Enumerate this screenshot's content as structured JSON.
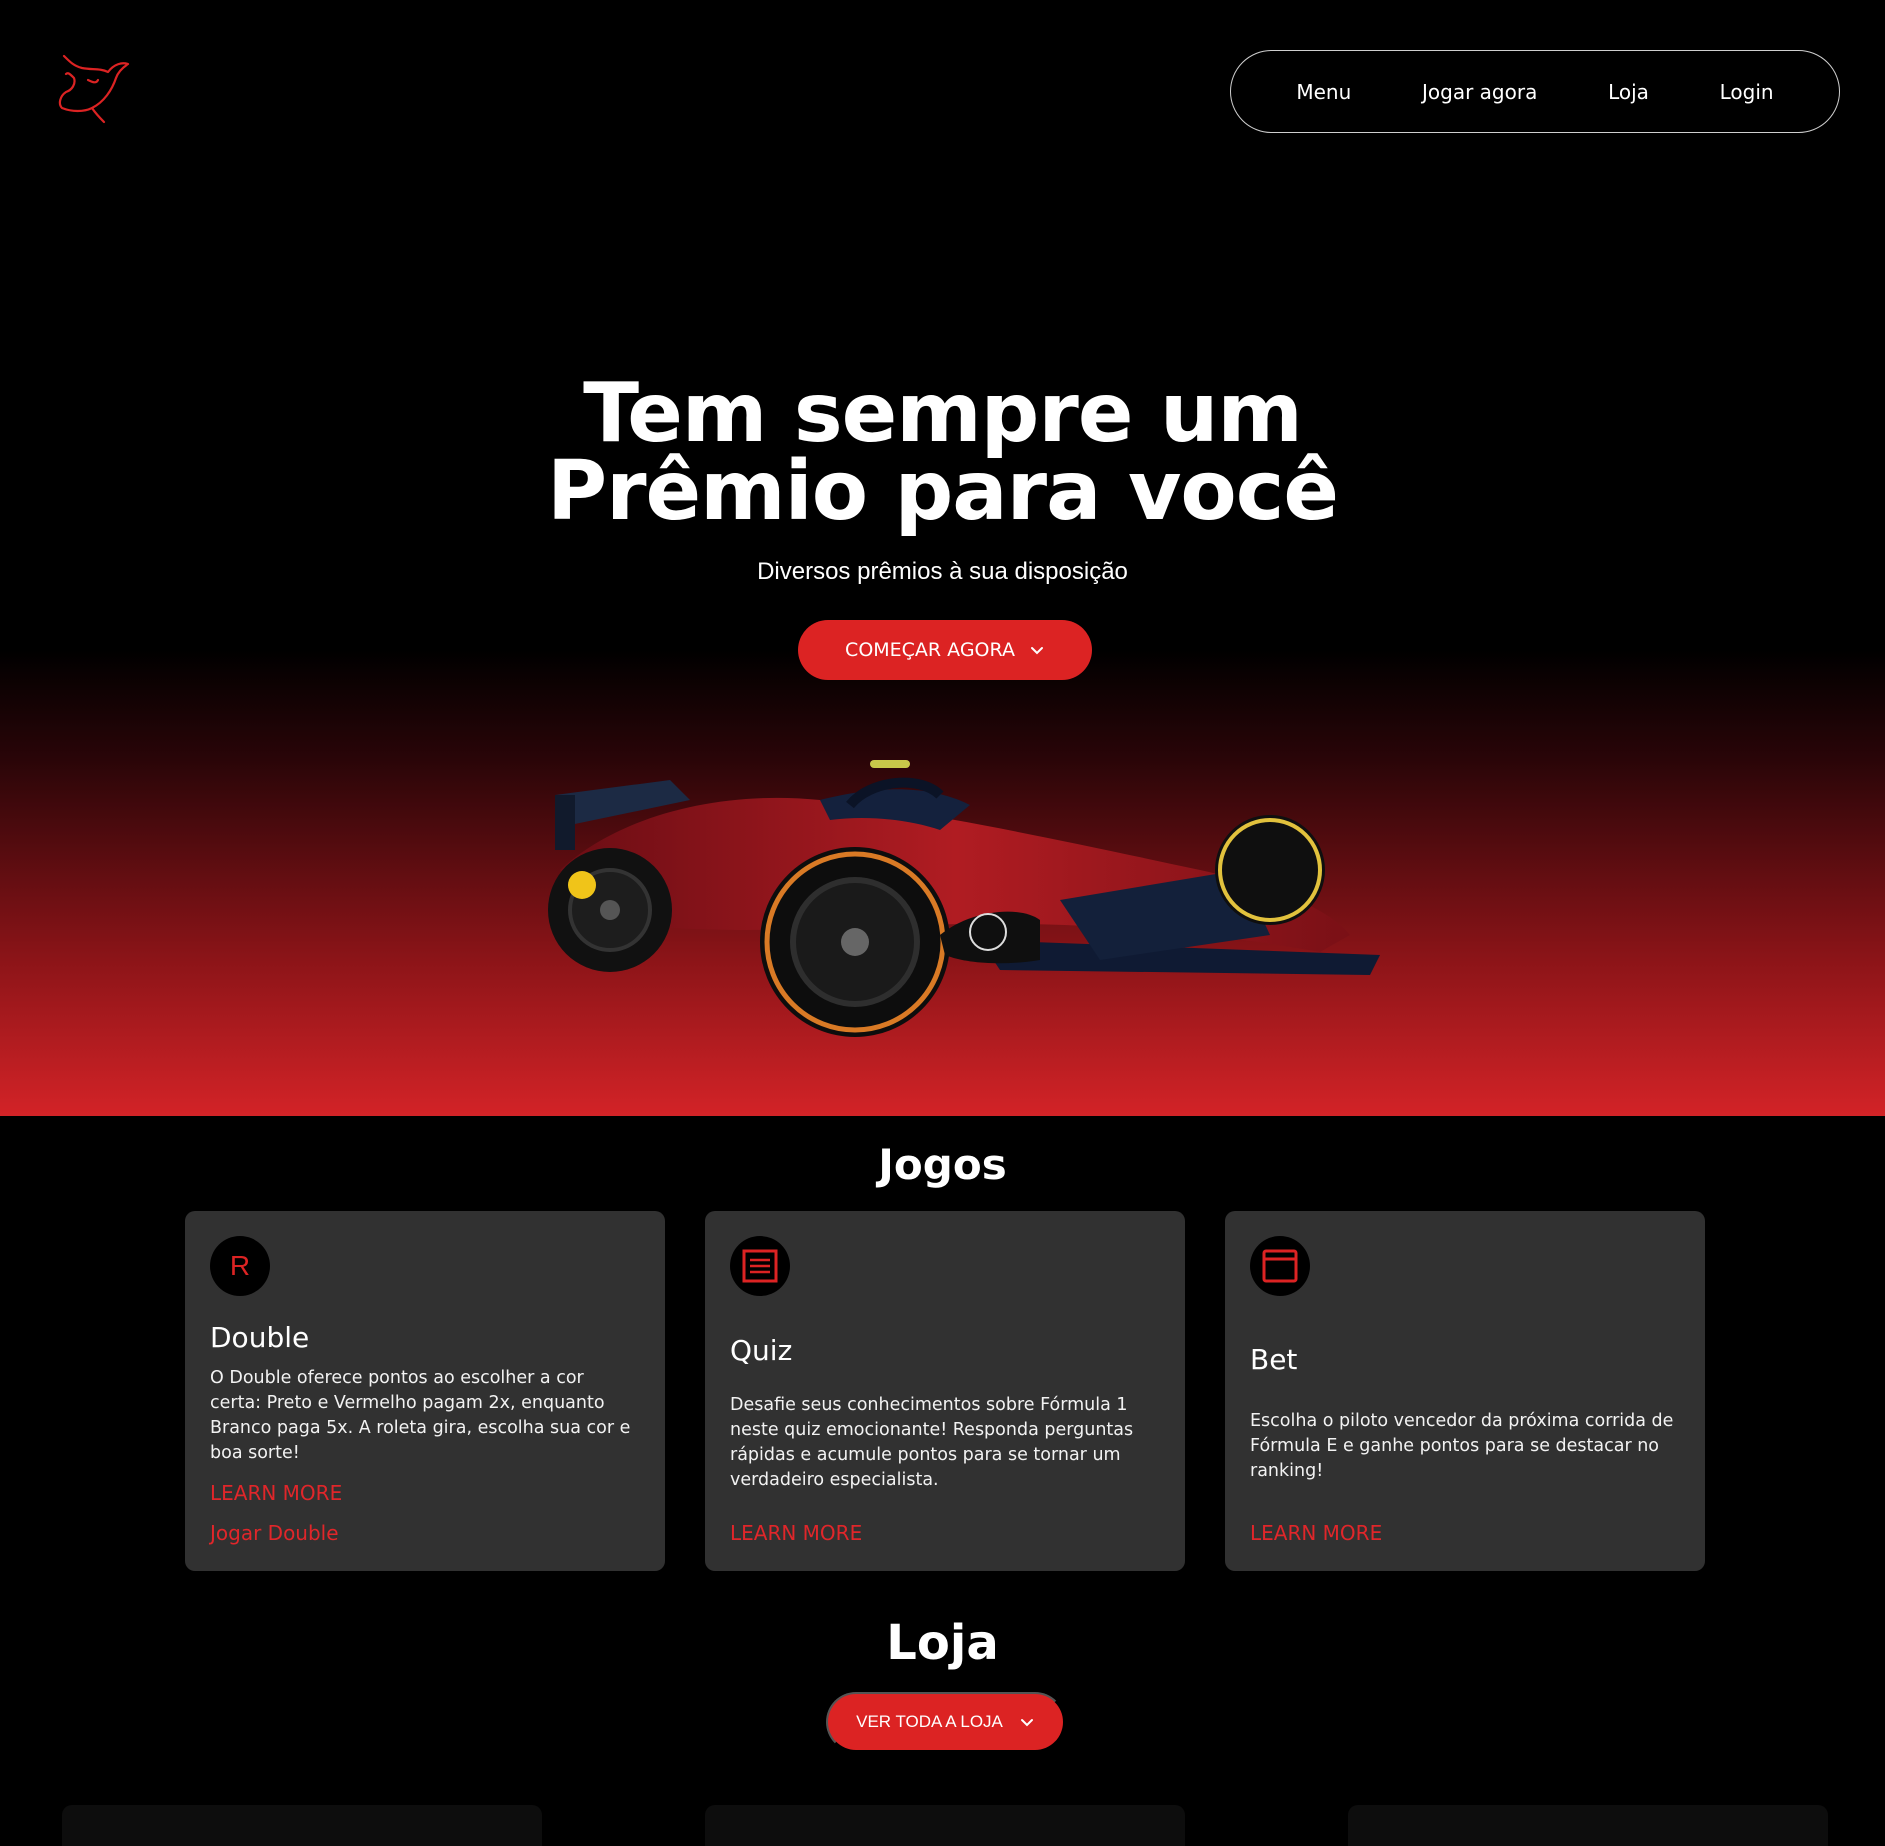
{
  "header": {
    "nav": [
      {
        "label": "Menu"
      },
      {
        "label": "Jogar agora"
      },
      {
        "label": "Loja"
      },
      {
        "label": "Login"
      }
    ]
  },
  "hero": {
    "title_line1": "Tem sempre um",
    "title_line2": "Prêmio para você",
    "subtitle": "Diversos prêmios à sua disposição",
    "cta_label": "COMEÇAR AGORA"
  },
  "jogos": {
    "title": "Jogos",
    "cards": [
      {
        "icon": "r-letter-icon",
        "icon_letter": "R",
        "title": "Double",
        "description": "O Double oferece pontos ao escolher a cor certa: Preto e Vermelho pagam 2x, enquanto Branco paga 5x. A roleta gira, escolha sua cor e boa sorte!",
        "learn_more": "LEARN MORE",
        "play": "Jogar Double"
      },
      {
        "icon": "list-icon",
        "title": "Quiz",
        "description": "Desafie seus conhecimentos sobre Fórmula 1 neste quiz emocionante! Responda perguntas rápidas e acumule pontos para se tornar um verdadeiro especialista.",
        "learn_more": "LEARN MORE"
      },
      {
        "icon": "window-icon",
        "title": "Bet",
        "description": "Escolha o piloto vencedor da próxima corrida de Fórmula E e ganhe pontos para se destacar no ranking!",
        "learn_more": "LEARN MORE"
      }
    ]
  },
  "loja": {
    "title": "Loja",
    "cta_label": "VER TODA A LOJA"
  },
  "colors": {
    "accent": "#dc2323",
    "card_bg": "#313131",
    "background": "#000000"
  }
}
